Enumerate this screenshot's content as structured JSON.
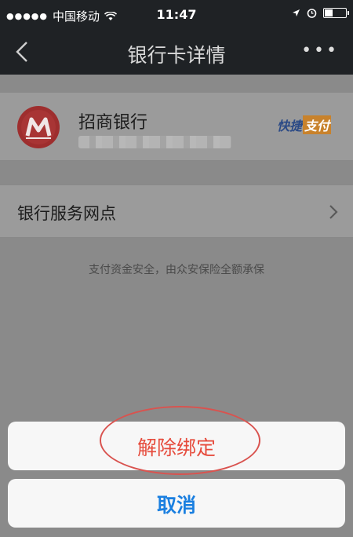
{
  "status_bar": {
    "carrier": "中国移动",
    "time": "11:47",
    "signal_dots": "●●●●●"
  },
  "nav": {
    "title": "银行卡详情",
    "back_icon": "chevron-left-icon",
    "more_icon": "more-dots-icon",
    "more_text": "•••"
  },
  "card": {
    "bank_name": "招商银行",
    "quickpay_part1": "快捷",
    "quickpay_part2": "支付",
    "logo_icon": "cmb-bank-logo-icon"
  },
  "service": {
    "label": "银行服务网点"
  },
  "safety_note": "支付资金安全，由众安保险全额承保",
  "action_sheet": {
    "unbind_label": "解除绑定",
    "cancel_label": "取消"
  },
  "colors": {
    "nav_bg": "#1f2225",
    "danger": "#e64b3c",
    "cancel": "#1a7fe0"
  }
}
